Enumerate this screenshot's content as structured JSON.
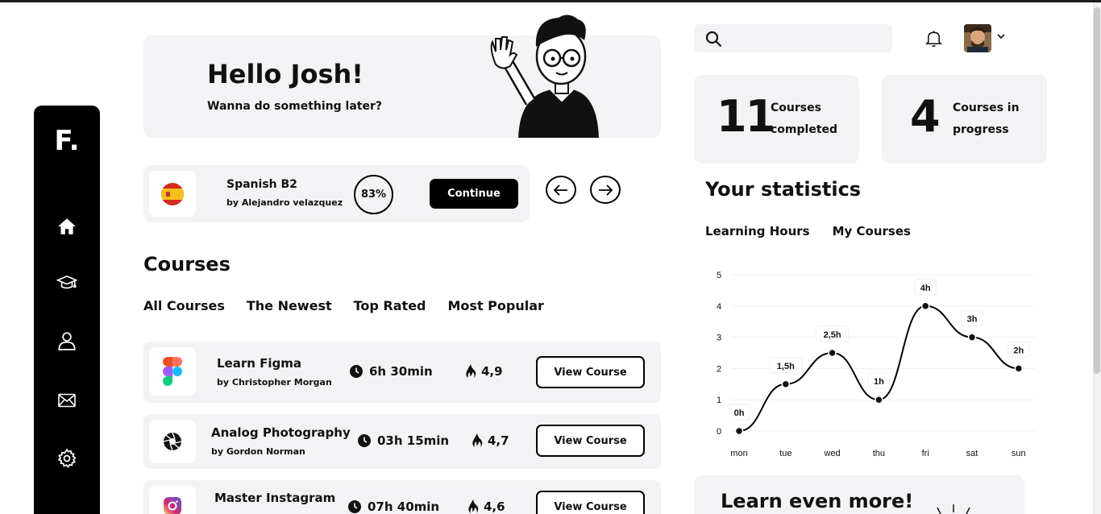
{
  "sidebar": {
    "logo": "F.",
    "items": [
      {
        "name": "home"
      },
      {
        "name": "courses"
      },
      {
        "name": "profile"
      },
      {
        "name": "messages"
      },
      {
        "name": "settings"
      }
    ]
  },
  "hello": {
    "title": "Hello Josh!",
    "subtitle": "Wanna do something later?"
  },
  "current_course": {
    "title": "Spanish B2",
    "author": "by Alejandro velazquez",
    "progress": "83%",
    "continue_label": "Continue"
  },
  "courses": {
    "title": "Courses",
    "filters": [
      "All Courses",
      "The Newest",
      "Top Rated",
      "Most Popular"
    ],
    "items": [
      {
        "title": "Learn Figma",
        "author": "by Christopher Morgan",
        "duration": "6h 30min",
        "rating": "4,9",
        "button": "View Course"
      },
      {
        "title": "Analog Photography",
        "author": "by Gordon Norman",
        "duration": "03h 15min",
        "rating": "4,7",
        "button": "View Course"
      },
      {
        "title": "Master Instagram",
        "author": "",
        "duration": "07h 40min",
        "rating": "4,6",
        "button": "View Course"
      }
    ]
  },
  "search": {
    "placeholder": ""
  },
  "stats": {
    "completed_num": "11",
    "completed_label_1": "Courses",
    "completed_label_2": "completed",
    "progress_num": "4",
    "progress_label_1": "Courses in",
    "progress_label_2": "progress",
    "title": "Your statistics",
    "tabs": [
      "Learning Hours",
      "My Courses"
    ]
  },
  "chart_data": {
    "type": "line",
    "categories": [
      "mon",
      "tue",
      "wed",
      "thu",
      "fri",
      "sat",
      "sun"
    ],
    "values": [
      0,
      1.5,
      2.5,
      1,
      4,
      3,
      2
    ],
    "point_labels": [
      "0h",
      "1,5h",
      "2,5h",
      "1h",
      "4h",
      "3h",
      "2h"
    ],
    "yticks": [
      "0",
      "1",
      "2",
      "3",
      "4",
      "5"
    ],
    "ylim": [
      0,
      5
    ],
    "grid": true,
    "line_color": "#000000"
  },
  "more": {
    "title": "Learn even more!"
  }
}
